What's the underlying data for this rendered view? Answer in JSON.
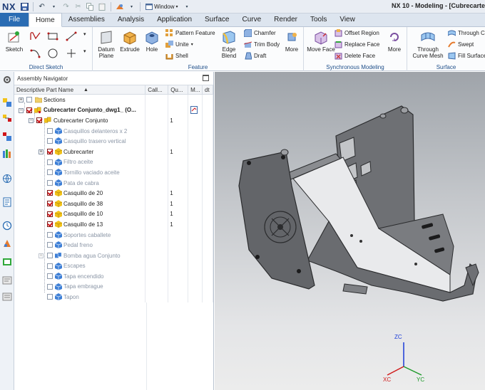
{
  "app": {
    "logo": "NX",
    "window_menu": "Window",
    "title": "NX 10 - Modeling - [Cubrecarte"
  },
  "tabs": [
    {
      "label": "File"
    },
    {
      "label": "Home"
    },
    {
      "label": "Assemblies"
    },
    {
      "label": "Analysis"
    },
    {
      "label": "Application"
    },
    {
      "label": "Surface"
    },
    {
      "label": "Curve"
    },
    {
      "label": "Render"
    },
    {
      "label": "Tools"
    },
    {
      "label": "View"
    }
  ],
  "ribbon": {
    "direct_sketch": {
      "label": "Direct Sketch",
      "sketch": "Sketch"
    },
    "feature": {
      "label": "Feature",
      "datum_plane": "Datum Plane",
      "extrude": "Extrude",
      "hole": "Hole",
      "pattern_feature": "Pattern Feature",
      "unite": "Unite",
      "shell": "Shell",
      "edge_blend": "Edge Blend",
      "chamfer": "Chamfer",
      "trim_body": "Trim Body",
      "draft": "Draft",
      "more": "More"
    },
    "synchronous": {
      "label": "Synchronous Modeling",
      "move_face": "Move Face",
      "offset_region": "Offset Region",
      "replace_face": "Replace Face",
      "delete_face": "Delete Face",
      "more": "More"
    },
    "surface": {
      "label": "Surface",
      "through_curve_mesh": "Through Curve Mesh",
      "through_curves": "Through Cu",
      "swept": "Swept",
      "fill_surface": "Fill Surface"
    }
  },
  "navigator": {
    "title": "Assembly Navigator",
    "columns": [
      "Descriptive Part Name",
      "Call...",
      "Qu...",
      "M...",
      "dt"
    ],
    "rows": [
      {
        "name": "Sections",
        "qty": ""
      },
      {
        "name": "Cubrecarter Conjunto_dwg1_ (O...",
        "qty": ""
      },
      {
        "name": "Cubrecarter Conjunto",
        "qty": "1"
      },
      {
        "name": "Casquillos delanteros x 2",
        "qty": ""
      },
      {
        "name": "Casquillo trasero vertical",
        "qty": ""
      },
      {
        "name": "Cubrecarter",
        "qty": "1"
      },
      {
        "name": "Filtro aceite",
        "qty": ""
      },
      {
        "name": "Tornillo vaciado aceite",
        "qty": ""
      },
      {
        "name": "Pata de cabra",
        "qty": ""
      },
      {
        "name": "Casquillo de 20",
        "qty": "1"
      },
      {
        "name": "Casquillo de 38",
        "qty": "1"
      },
      {
        "name": "Casquillo de 10",
        "qty": "1"
      },
      {
        "name": "Casquillo de 13",
        "qty": "1"
      },
      {
        "name": "Soportes caballete",
        "qty": ""
      },
      {
        "name": "Pedal freno",
        "qty": ""
      },
      {
        "name": "Bomba agua Conjunto",
        "qty": ""
      },
      {
        "name": "Escapes",
        "qty": ""
      },
      {
        "name": "Tapa encendido",
        "qty": ""
      },
      {
        "name": "Tapa embrague",
        "qty": ""
      },
      {
        "name": "Tapon",
        "qty": ""
      }
    ]
  },
  "triad": {
    "zc": "ZC",
    "xc": "XC",
    "yc": "YC"
  },
  "colors": {
    "accent": "#2a6cb3",
    "check": "#d0151a",
    "part_yellow": "#f2c21a",
    "part_blue": "#3e7fd6"
  }
}
